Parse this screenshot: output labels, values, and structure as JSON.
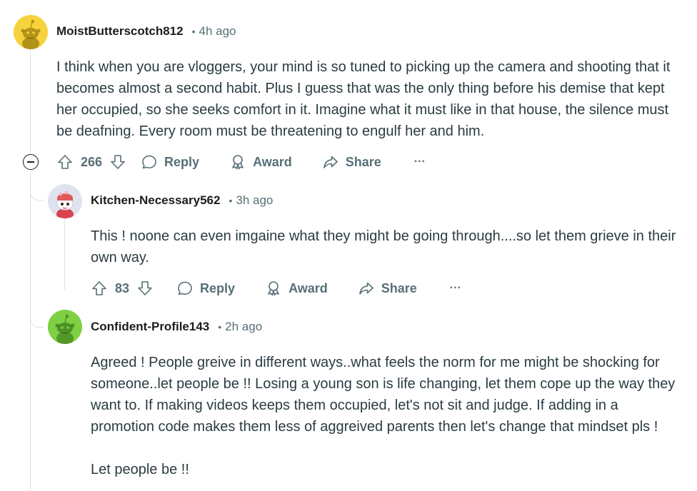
{
  "comments": [
    {
      "username": "MoistButterscotch812",
      "sep": "•",
      "time": "4h ago",
      "avatar_color": "#f6d33c",
      "body": "I think when you are vloggers, your mind is so tuned to picking up the camera and shooting that it becomes almost a second habit. Plus I guess that was the only thing before his demise that kept her occupied, so she seeks comfort in it. Imagine what it must like in that house, the silence must be deafning. Every room must be threatening to engulf her and him.",
      "votes": "266",
      "reply_label": "Reply",
      "award_label": "Award",
      "share_label": "Share",
      "more_label": "···"
    },
    {
      "username": "Kitchen-Necessary562",
      "sep": "•",
      "time": "3h ago",
      "avatar_color": "#dfe3f0",
      "body": "This ! noone can even imgaine what they might be going through....so let them grieve in their own way.",
      "votes": "83",
      "reply_label": "Reply",
      "award_label": "Award",
      "share_label": "Share",
      "more_label": "···"
    },
    {
      "username": "Confident-Profile143",
      "sep": "•",
      "time": "2h ago",
      "avatar_color": "#7fd045",
      "body": "Agreed ! People greive in different ways..what feels the norm for me might be shocking for someone..let people be !! Losing a young son is life changing, let them cope up the way they want to. If making videos keeps them occupied, let's not sit and judge. If adding in a promotion code makes them less of aggreived parents then let's change that mindset pls !",
      "body2": "Let people be !!"
    }
  ],
  "colors": {
    "text": "#1c1c1c",
    "muted": "#576f76",
    "body": "#2a3c42",
    "thread_line": "#dfe2e5"
  },
  "icons": [
    "upvote-icon",
    "downvote-icon",
    "comment-bubble-icon",
    "award-icon",
    "share-icon",
    "more-icon",
    "collapse-icon"
  ]
}
